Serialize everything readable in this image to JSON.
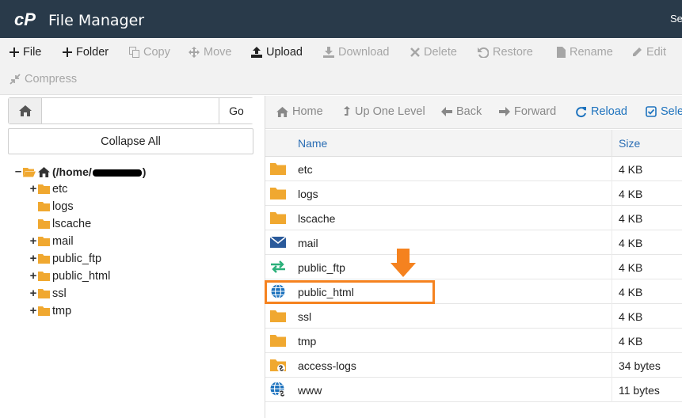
{
  "header": {
    "title": "File Manager",
    "right_text": "Se"
  },
  "toolbar": {
    "file": "File",
    "folder": "Folder",
    "copy": "Copy",
    "move": "Move",
    "upload": "Upload",
    "download": "Download",
    "delete": "Delete",
    "restore": "Restore",
    "rename": "Rename",
    "edit": "Edit",
    "compress": "Compress"
  },
  "left": {
    "path_value": "",
    "go": "Go",
    "collapse_all": "Collapse All",
    "tree_root_prefix": "(/home/",
    "tree_root_suffix": ")",
    "tree": [
      {
        "label": "etc",
        "expandable": true
      },
      {
        "label": "logs",
        "expandable": false
      },
      {
        "label": "lscache",
        "expandable": false
      },
      {
        "label": "mail",
        "expandable": true
      },
      {
        "label": "public_ftp",
        "expandable": true
      },
      {
        "label": "public_html",
        "expandable": true
      },
      {
        "label": "ssl",
        "expandable": true
      },
      {
        "label": "tmp",
        "expandable": true
      }
    ]
  },
  "nav": {
    "home": "Home",
    "up": "Up One Level",
    "back": "Back",
    "forward": "Forward",
    "reload": "Reload",
    "select": "Selec"
  },
  "table": {
    "col_name": "Name",
    "col_size": "Size",
    "rows": [
      {
        "name": "etc",
        "size": "4 KB",
        "icon": "folder-icon"
      },
      {
        "name": "logs",
        "size": "4 KB",
        "icon": "folder-icon"
      },
      {
        "name": "lscache",
        "size": "4 KB",
        "icon": "folder-icon"
      },
      {
        "name": "mail",
        "size": "4 KB",
        "icon": "mail-icon"
      },
      {
        "name": "public_ftp",
        "size": "4 KB",
        "icon": "transfer-icon"
      },
      {
        "name": "public_html",
        "size": "4 KB",
        "icon": "globe-icon"
      },
      {
        "name": "ssl",
        "size": "4 KB",
        "icon": "folder-icon"
      },
      {
        "name": "tmp",
        "size": "4 KB",
        "icon": "folder-icon"
      },
      {
        "name": "access-logs",
        "size": "34 bytes",
        "icon": "folder-link-icon"
      },
      {
        "name": "www",
        "size": "11 bytes",
        "icon": "globe-link-icon"
      }
    ]
  },
  "colors": {
    "header_bg": "#293a4a",
    "folder": "#f0a830",
    "link_blue": "#1e73be",
    "highlight": "#f5821f"
  }
}
